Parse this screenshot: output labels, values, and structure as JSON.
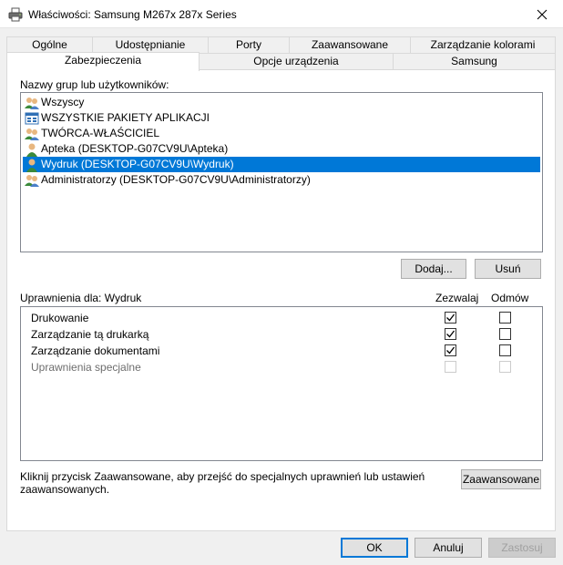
{
  "window": {
    "title": "Właściwości: Samsung M267x 287x Series",
    "printer_icon": "printer-icon",
    "close_icon": "close-icon"
  },
  "tabs_row1": [
    "Ogólne",
    "Udostępnianie",
    "Porty",
    "Zaawansowane",
    "Zarządzanie kolorami"
  ],
  "tabs_row2": [
    "Zabezpieczenia",
    "Opcje urządzenia",
    "Samsung"
  ],
  "active_tab": "Zabezpieczenia",
  "security": {
    "groups_label": "Nazwy grup lub użytkowników:",
    "groups": [
      {
        "name": "Wszyscy",
        "icon": "users-group-icon",
        "selected": false
      },
      {
        "name": "WSZYSTKIE PAKIETY APLIKACJI",
        "icon": "app-packages-icon",
        "selected": false
      },
      {
        "name": "TWÓRCA-WŁAŚCICIEL",
        "icon": "users-group-icon",
        "selected": false
      },
      {
        "name": "Apteka (DESKTOP-G07CV9U\\Apteka)",
        "icon": "user-icon",
        "selected": false
      },
      {
        "name": "Wydruk (DESKTOP-G07CV9U\\Wydruk)",
        "icon": "user-icon",
        "selected": true
      },
      {
        "name": "Administratorzy (DESKTOP-G07CV9U\\Administratorzy)",
        "icon": "users-group-icon",
        "selected": false
      }
    ],
    "add_button": "Dodaj...",
    "remove_button": "Usuń",
    "permissions_label": "Uprawnienia dla: Wydruk",
    "allow_header": "Zezwalaj",
    "deny_header": "Odmów",
    "permissions": [
      {
        "name": "Drukowanie",
        "allow": true,
        "deny": false,
        "disabled": false
      },
      {
        "name": "Zarządzanie tą drukarką",
        "allow": true,
        "deny": false,
        "disabled": false
      },
      {
        "name": "Zarządzanie dokumentami",
        "allow": true,
        "deny": false,
        "disabled": false
      },
      {
        "name": "Uprawnienia specjalne",
        "allow": false,
        "deny": false,
        "disabled": true
      }
    ],
    "advanced_hint_line1": "Kliknij przycisk Zaawansowane, aby przejść do specjalnych uprawnień lub ustawień",
    "advanced_hint_line2": "zaawansowanych.",
    "advanced_button": "Zaawansowane"
  },
  "footer": {
    "ok": "OK",
    "cancel": "Anuluj",
    "apply": "Zastosuj"
  }
}
